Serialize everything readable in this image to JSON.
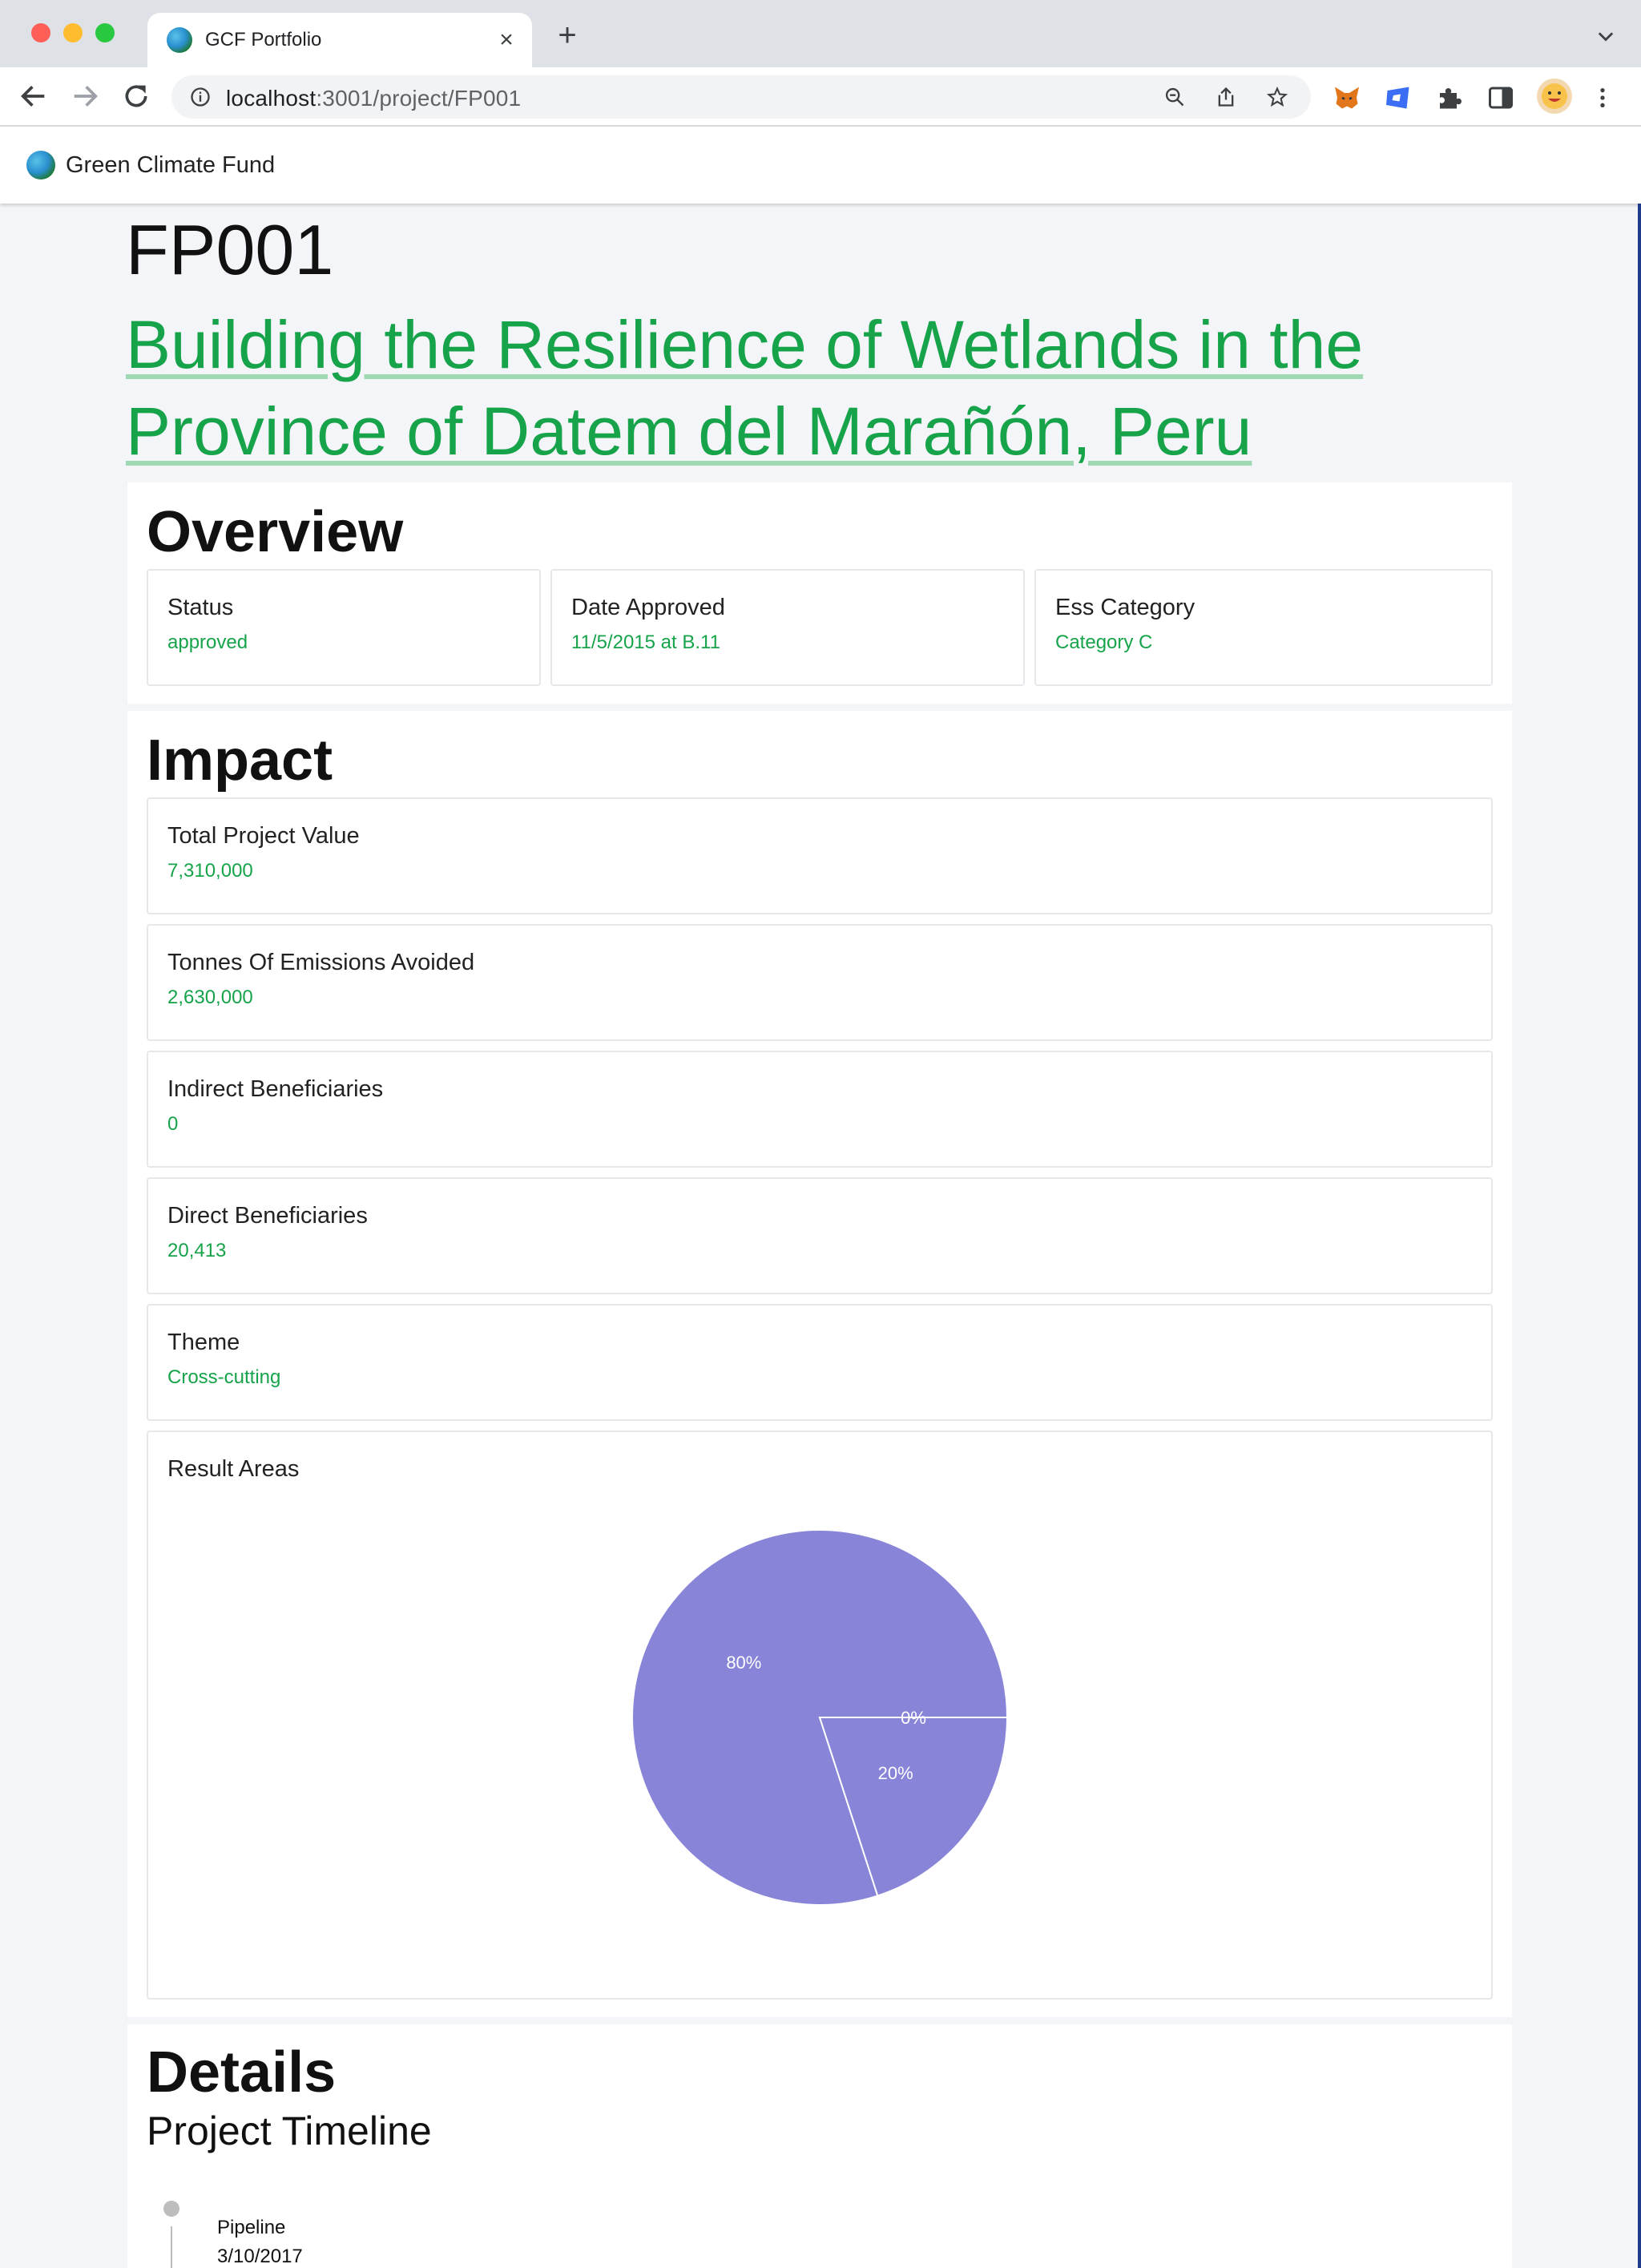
{
  "browser": {
    "tab_title": "GCF Portfolio",
    "tab_close": "×",
    "new_tab": "+",
    "url_host": "localhost",
    "url_rest": ":3001/project/FP001"
  },
  "app": {
    "name": "Green Climate Fund"
  },
  "project": {
    "id": "FP001",
    "title": "Building the Resilience of Wetlands in the Province of Datem del Marañón, Peru"
  },
  "overview": {
    "title": "Overview",
    "cards": [
      {
        "label": "Status",
        "value": "approved"
      },
      {
        "label": "Date Approved",
        "value": "11/5/2015 at B.11"
      },
      {
        "label": "Ess Category",
        "value": "Category C"
      }
    ]
  },
  "impact": {
    "title": "Impact",
    "cards": [
      {
        "label": "Total Project Value",
        "value": "7,310,000"
      },
      {
        "label": "Tonnes Of Emissions Avoided",
        "value": "2,630,000"
      },
      {
        "label": "Indirect Beneficiaries",
        "value": "0"
      },
      {
        "label": "Direct Beneficiaries",
        "value": "20,413"
      },
      {
        "label": "Theme",
        "value": "Cross-cutting"
      }
    ],
    "result_areas_label": "Result Areas"
  },
  "chart_data": {
    "type": "pie",
    "color": "#8884d8",
    "slices": [
      {
        "label": "80%",
        "value": 80
      },
      {
        "label": "20%",
        "value": 20
      },
      {
        "label": "0%",
        "value": 0
      }
    ]
  },
  "details": {
    "title": "Details",
    "timeline_title": "Project Timeline",
    "timeline": [
      {
        "label": "Pipeline",
        "date": "3/10/2017"
      }
    ]
  },
  "colors": {
    "accent": "#16a34a",
    "pie": "#8884d8"
  }
}
